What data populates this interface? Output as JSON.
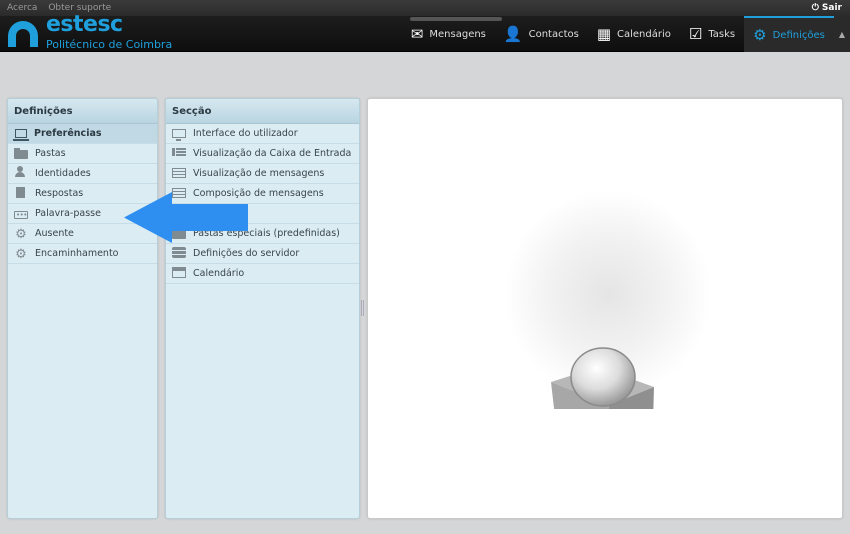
{
  "topbar": {
    "links": [
      "Acerca",
      "Obter suporte"
    ],
    "logout_label": "Sair"
  },
  "logo": {
    "brand": "estesc",
    "subtitle": "Politécnico de Coimbra",
    "color": "#1fa0dc"
  },
  "nav": [
    {
      "label": "Mensagens",
      "icon": "envelope-icon"
    },
    {
      "label": "Contactos",
      "icon": "person-icon"
    },
    {
      "label": "Calendário",
      "icon": "calendar-icon"
    },
    {
      "label": "Tasks",
      "icon": "checkbox-icon"
    },
    {
      "label": "Definições",
      "icon": "gear-icon",
      "active": true
    }
  ],
  "settings": {
    "title": "Definições",
    "items": [
      {
        "label": "Preferências",
        "icon": "laptop-icon",
        "selected": true
      },
      {
        "label": "Pastas",
        "icon": "folder-icon"
      },
      {
        "label": "Identidades",
        "icon": "person-icon"
      },
      {
        "label": "Respostas",
        "icon": "document-icon"
      },
      {
        "label": "Palavra-passe",
        "icon": "password-icon"
      },
      {
        "label": "Ausente",
        "icon": "gear-icon"
      },
      {
        "label": "Encaminhamento",
        "icon": "gear-icon"
      }
    ]
  },
  "section": {
    "title": "Secção",
    "items": [
      {
        "label": "Interface do utilizador",
        "icon": "monitor-icon"
      },
      {
        "label": "Visualização da Caixa de Entrada",
        "icon": "rows-icon"
      },
      {
        "label": "Visualização de mensagens",
        "icon": "message-view-icon"
      },
      {
        "label": "Composição de mensagens",
        "icon": "compose-icon"
      },
      {
        "label": "",
        "icon": "contacts-icon"
      },
      {
        "label": "Pastas especiais (predefinidas)",
        "icon": "folder-icon"
      },
      {
        "label": "Definições do servidor",
        "icon": "server-icon"
      },
      {
        "label": "Calendário",
        "icon": "calendar-icon"
      }
    ]
  },
  "colors": {
    "accent": "#1fa0dc",
    "arrow": "#2f8ff0",
    "pane_bg": "#dcecf3"
  }
}
